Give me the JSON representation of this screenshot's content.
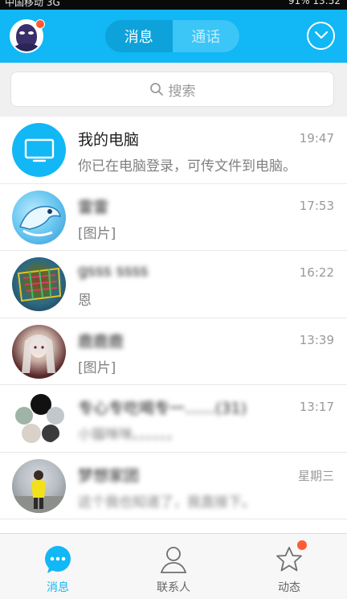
{
  "status_bar": {
    "carrier": "中国移动 3G",
    "battery": "91%",
    "time": "13:52"
  },
  "header": {
    "tabs": [
      {
        "label": "消息",
        "active": true
      },
      {
        "label": "通话",
        "active": false
      }
    ],
    "accent_color": "#12b7f5",
    "icons": {
      "avatar": "user-avatar",
      "badge": "notification-dot",
      "more": "chevron-down-circle-icon"
    }
  },
  "search": {
    "placeholder": "搜索",
    "icon": "search-icon"
  },
  "conversations": [
    {
      "name": "我的电脑",
      "time": "19:47",
      "preview": "你已在电脑登录，可传文件到电脑。",
      "avatar": "computer-avatar"
    },
    {
      "name": "雷雷",
      "time": "17:53",
      "preview": "[图片]",
      "avatar": "dolphin-avatar"
    },
    {
      "name": "gsss ssss",
      "time": "16:22",
      "preview": "恩",
      "avatar": "colorful-avatar"
    },
    {
      "name": "鹿鹿鹿",
      "time": "13:39",
      "preview": "[图片]",
      "avatar": "girl-avatar"
    },
    {
      "name": "专心专吃喝专一……(31)",
      "time": "13:17",
      "preview": "小猫咪咪。。。。。。",
      "avatar": "group-avatar"
    },
    {
      "name": "梦想家团",
      "time": "星期三",
      "preview": "这个我也知道了，我直接下。",
      "avatar": "person-avatar"
    }
  ],
  "tab_bar": {
    "tabs": [
      {
        "label": "消息",
        "icon": "chat-bubble-icon",
        "active": true
      },
      {
        "label": "联系人",
        "icon": "contacts-icon",
        "active": false
      },
      {
        "label": "动态",
        "icon": "star-icon",
        "active": false
      }
    ]
  }
}
